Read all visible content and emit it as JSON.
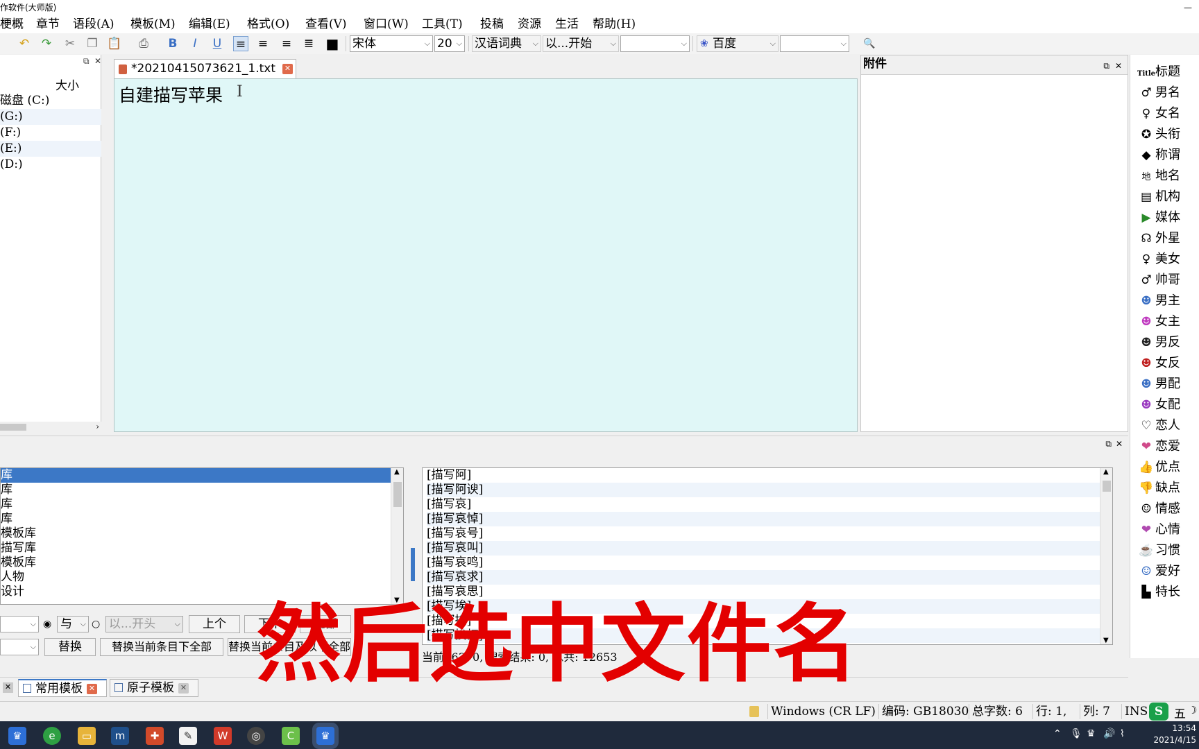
{
  "app": {
    "title": "作软件(大师版)"
  },
  "menu": [
    "梗概",
    "章节",
    "语段(A)",
    "模板(M)",
    "编辑(E)",
    "格式(O)",
    "查看(V)",
    "窗口(W)",
    "工具(T)",
    "投稿",
    "资源",
    "生活",
    "帮助(H)"
  ],
  "toolbar": {
    "font": "宋体",
    "size": "20",
    "dict": "汉语词典",
    "match": "以...开始",
    "search_engine": "百度",
    "icons": [
      "undo-icon",
      "redo-icon",
      "cut-icon",
      "copy-icon",
      "paste-icon",
      "print-icon",
      "bold-icon",
      "italic-icon",
      "underline-icon",
      "align-left-icon",
      "align-center-icon",
      "align-right-icon",
      "justify-icon",
      "color-icon",
      "search-icon"
    ]
  },
  "file_panel": {
    "size_header": "大小",
    "drives": [
      "磁盘 (C:)",
      "(G:)",
      "(F:)",
      "(E:)",
      "(D:)"
    ]
  },
  "editor": {
    "tab_name": "*20210415073621_1.txt",
    "content": "自建描写苹果",
    "background": "#e0f7f7"
  },
  "attach": {
    "title": "附件"
  },
  "sidebar": {
    "items": [
      {
        "icon": "Title",
        "label": "标题"
      },
      {
        "icon": "♂",
        "label": "男名"
      },
      {
        "icon": "♀",
        "label": "女名"
      },
      {
        "icon": "✪",
        "label": "头衔"
      },
      {
        "icon": "◆",
        "label": "称谓"
      },
      {
        "icon": "地",
        "label": "地名"
      },
      {
        "icon": "▤",
        "label": "机构"
      },
      {
        "icon": "▶",
        "label": "媒体"
      },
      {
        "icon": "☊",
        "label": "外星"
      },
      {
        "icon": "♀",
        "label": "美女"
      },
      {
        "icon": "♂",
        "label": "帅哥"
      },
      {
        "icon": "☻",
        "label": "男主"
      },
      {
        "icon": "☻",
        "label": "女主"
      },
      {
        "icon": "☻",
        "label": "男反"
      },
      {
        "icon": "☻",
        "label": "女反"
      },
      {
        "icon": "☻",
        "label": "男配"
      },
      {
        "icon": "☻",
        "label": "女配"
      },
      {
        "icon": "♡",
        "label": "恋人"
      },
      {
        "icon": "❤",
        "label": "恋爱"
      },
      {
        "icon": "👍",
        "label": "优点"
      },
      {
        "icon": "👎",
        "label": "缺点"
      },
      {
        "icon": "☺",
        "label": "情感"
      },
      {
        "icon": "❤",
        "label": "心情"
      },
      {
        "icon": "☕",
        "label": "习惯"
      },
      {
        "icon": "☺",
        "label": "爱好"
      },
      {
        "icon": "▙",
        "label": "特长"
      }
    ]
  },
  "category_list": {
    "items": [
      "库",
      "库",
      "库",
      "库",
      "模板库",
      "描写库",
      "模板库",
      "人物",
      "设计"
    ],
    "selected_index": 0
  },
  "results": {
    "items": [
      "[描写阿]",
      "[描写阿谀]",
      "[描写哀]",
      "[描写哀悼]",
      "[描写哀号]",
      "[描写哀叫]",
      "[描写哀鸣]",
      "[描写哀求]",
      "[描写哀思]",
      "[描写埃]",
      "[描写挨]",
      "[描写挨打]"
    ],
    "counter": "当前: 6370, 搜索结果: 0, 总共: 12653"
  },
  "search_controls": {
    "logic": "与",
    "match_mode": "以...开头",
    "prev": "上个",
    "next": "下个",
    "all": "全部",
    "replace": "替换",
    "replace_all_current": "替换当前条目下全部",
    "replace_all_below": "替换当前条目及以下全部"
  },
  "bottom_tabs": [
    "常用模板",
    "原子模板"
  ],
  "statusbar": {
    "line_ending": "Windows (CR LF)",
    "encoding": "编码: GB18030",
    "char_count": "总字数: 6",
    "line": "行: 1,",
    "col": "列: 7",
    "mode": "INS"
  },
  "taskbar": {
    "time": "13:54",
    "date": "2021/4/15",
    "ime": "五"
  },
  "overlay_caption": "然后选中文件名"
}
